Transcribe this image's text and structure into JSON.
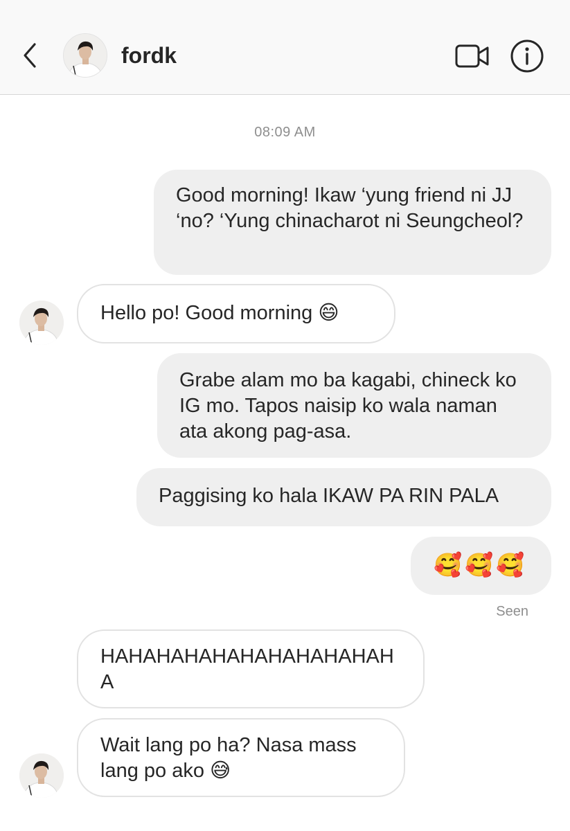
{
  "header": {
    "username": "fordk",
    "back_icon": "chevron-left-icon",
    "video_icon": "video-camera-icon",
    "info_icon": "info-circle-icon"
  },
  "conversation": {
    "timestamp": "08:09 AM",
    "messages": [
      {
        "direction": "outgoing",
        "text": "Good morning! Ikaw ‘yung friend ni JJ ‘no? ‘Yung chinacharot ni Seungcheol?"
      },
      {
        "direction": "incoming",
        "text": "Hello po! Good morning 😄"
      },
      {
        "direction": "outgoing",
        "text": "Grabe alam mo ba kagabi, chineck ko IG mo. Tapos naisip ko wala naman ata akong pag-asa."
      },
      {
        "direction": "outgoing",
        "text": "Paggising ko hala IKAW PA RIN PALA"
      },
      {
        "direction": "outgoing",
        "text": "🥰🥰🥰"
      },
      {
        "direction": "incoming",
        "text": "HAHAHAHAHAHAHAHAHAHAHA"
      },
      {
        "direction": "incoming",
        "text": "Wait lang po ha? Nasa mass lang po ako 😅"
      }
    ],
    "seen_label": "Seen"
  },
  "colors": {
    "header_bg": "#f9f9f9",
    "outgoing_bubble": "#efefef",
    "incoming_border": "#e2e2e2",
    "meta_text": "#8e8e8e",
    "text": "#262626"
  }
}
